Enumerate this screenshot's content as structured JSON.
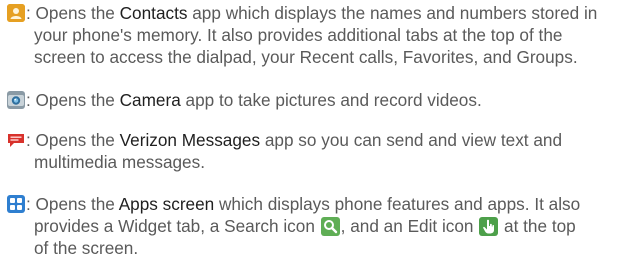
{
  "colors": {
    "body_text": "#5a5a5a",
    "highlight_text": "#1f1f1f",
    "contacts_icon": "#e0a020",
    "camera_icon": "#3a7fb0",
    "messages_icon": "#d8322c",
    "apps_icon": "#2f7fd0",
    "search_icon": "#5fae55",
    "edit_icon": "#4da04a"
  },
  "entries": [
    {
      "icon": "contacts-icon",
      "line1_pre": ": Opens the ",
      "app_name": "Contacts",
      "line1_post": " app which displays the names and numbers stored in",
      "line2": "your phone's memory. It also provides additional tabs at the top of the",
      "line3": "screen to access the dialpad, your Recent calls, Favorites, and Groups."
    },
    {
      "icon": "camera-icon",
      "line1_pre": ": Opens the ",
      "app_name": "Camera",
      "line1_post": " app to take pictures and record videos."
    },
    {
      "icon": "messages-icon",
      "line1_pre": ": Opens the ",
      "app_name": "Verizon Messages",
      "line1_post": " app so you can send and view text and",
      "line2": "multimedia messages."
    },
    {
      "icon": "apps-icon",
      "line1_pre": ": Opens the ",
      "app_name": "Apps screen",
      "line1_post": " which displays phone features and apps. It also",
      "line2_pre": "provides a Widget tab, a Search icon ",
      "line2_mid": ", and an Edit icon ",
      "line2_post": " at the top",
      "line3": "of the screen.",
      "inline_icons": [
        "search-icon",
        "edit-icon"
      ]
    }
  ]
}
